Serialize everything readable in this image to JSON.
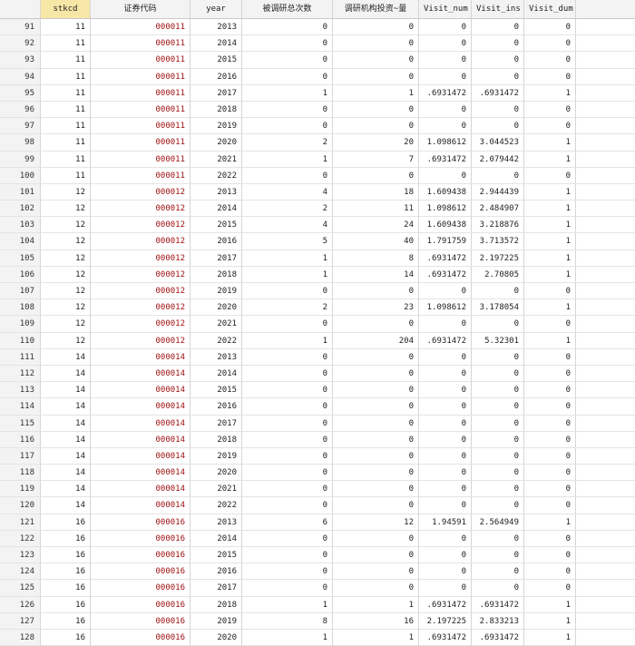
{
  "columns": [
    "stkcd",
    "证券代码",
    "year",
    "被调研总次数",
    "调研机构投资~量",
    "Visit_num",
    "Visit_ins",
    "Visit_dum"
  ],
  "rows": [
    [
      "91",
      "11",
      "000011",
      "2013",
      "0",
      "0",
      "0",
      "0",
      "0"
    ],
    [
      "92",
      "11",
      "000011",
      "2014",
      "0",
      "0",
      "0",
      "0",
      "0"
    ],
    [
      "93",
      "11",
      "000011",
      "2015",
      "0",
      "0",
      "0",
      "0",
      "0"
    ],
    [
      "94",
      "11",
      "000011",
      "2016",
      "0",
      "0",
      "0",
      "0",
      "0"
    ],
    [
      "95",
      "11",
      "000011",
      "2017",
      "1",
      "1",
      ".6931472",
      ".6931472",
      "1"
    ],
    [
      "96",
      "11",
      "000011",
      "2018",
      "0",
      "0",
      "0",
      "0",
      "0"
    ],
    [
      "97",
      "11",
      "000011",
      "2019",
      "0",
      "0",
      "0",
      "0",
      "0"
    ],
    [
      "98",
      "11",
      "000011",
      "2020",
      "2",
      "20",
      "1.098612",
      "3.044523",
      "1"
    ],
    [
      "99",
      "11",
      "000011",
      "2021",
      "1",
      "7",
      ".6931472",
      "2.079442",
      "1"
    ],
    [
      "100",
      "11",
      "000011",
      "2022",
      "0",
      "0",
      "0",
      "0",
      "0"
    ],
    [
      "101",
      "12",
      "000012",
      "2013",
      "4",
      "18",
      "1.609438",
      "2.944439",
      "1"
    ],
    [
      "102",
      "12",
      "000012",
      "2014",
      "2",
      "11",
      "1.098612",
      "2.484907",
      "1"
    ],
    [
      "103",
      "12",
      "000012",
      "2015",
      "4",
      "24",
      "1.609438",
      "3.218876",
      "1"
    ],
    [
      "104",
      "12",
      "000012",
      "2016",
      "5",
      "40",
      "1.791759",
      "3.713572",
      "1"
    ],
    [
      "105",
      "12",
      "000012",
      "2017",
      "1",
      "8",
      ".6931472",
      "2.197225",
      "1"
    ],
    [
      "106",
      "12",
      "000012",
      "2018",
      "1",
      "14",
      ".6931472",
      "2.70805",
      "1"
    ],
    [
      "107",
      "12",
      "000012",
      "2019",
      "0",
      "0",
      "0",
      "0",
      "0"
    ],
    [
      "108",
      "12",
      "000012",
      "2020",
      "2",
      "23",
      "1.098612",
      "3.178054",
      "1"
    ],
    [
      "109",
      "12",
      "000012",
      "2021",
      "0",
      "0",
      "0",
      "0",
      "0"
    ],
    [
      "110",
      "12",
      "000012",
      "2022",
      "1",
      "204",
      ".6931472",
      "5.32301",
      "1"
    ],
    [
      "111",
      "14",
      "000014",
      "2013",
      "0",
      "0",
      "0",
      "0",
      "0"
    ],
    [
      "112",
      "14",
      "000014",
      "2014",
      "0",
      "0",
      "0",
      "0",
      "0"
    ],
    [
      "113",
      "14",
      "000014",
      "2015",
      "0",
      "0",
      "0",
      "0",
      "0"
    ],
    [
      "114",
      "14",
      "000014",
      "2016",
      "0",
      "0",
      "0",
      "0",
      "0"
    ],
    [
      "115",
      "14",
      "000014",
      "2017",
      "0",
      "0",
      "0",
      "0",
      "0"
    ],
    [
      "116",
      "14",
      "000014",
      "2018",
      "0",
      "0",
      "0",
      "0",
      "0"
    ],
    [
      "117",
      "14",
      "000014",
      "2019",
      "0",
      "0",
      "0",
      "0",
      "0"
    ],
    [
      "118",
      "14",
      "000014",
      "2020",
      "0",
      "0",
      "0",
      "0",
      "0"
    ],
    [
      "119",
      "14",
      "000014",
      "2021",
      "0",
      "0",
      "0",
      "0",
      "0"
    ],
    [
      "120",
      "14",
      "000014",
      "2022",
      "0",
      "0",
      "0",
      "0",
      "0"
    ],
    [
      "121",
      "16",
      "000016",
      "2013",
      "6",
      "12",
      "1.94591",
      "2.564949",
      "1"
    ],
    [
      "122",
      "16",
      "000016",
      "2014",
      "0",
      "0",
      "0",
      "0",
      "0"
    ],
    [
      "123",
      "16",
      "000016",
      "2015",
      "0",
      "0",
      "0",
      "0",
      "0"
    ],
    [
      "124",
      "16",
      "000016",
      "2016",
      "0",
      "0",
      "0",
      "0",
      "0"
    ],
    [
      "125",
      "16",
      "000016",
      "2017",
      "0",
      "0",
      "0",
      "0",
      "0"
    ],
    [
      "126",
      "16",
      "000016",
      "2018",
      "1",
      "1",
      ".6931472",
      ".6931472",
      "1"
    ],
    [
      "127",
      "16",
      "000016",
      "2019",
      "8",
      "16",
      "2.197225",
      "2.833213",
      "1"
    ],
    [
      "128",
      "16",
      "000016",
      "2020",
      "1",
      "1",
      ".6931472",
      ".6931472",
      "1"
    ]
  ]
}
